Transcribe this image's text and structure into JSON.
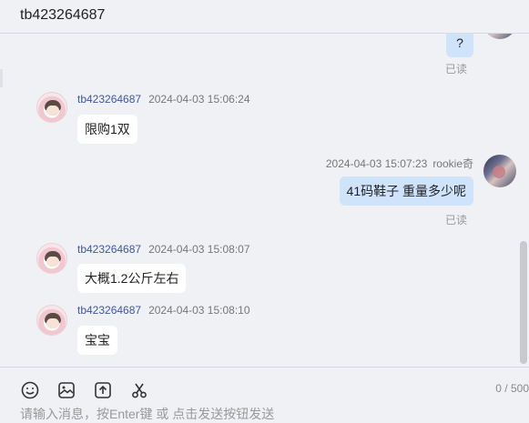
{
  "header": {
    "title": "tb423264687"
  },
  "messages": [
    {
      "side": "out",
      "text": "?",
      "status": "已读"
    },
    {
      "side": "in",
      "name": "tb423264687",
      "time": "2024-04-03 15:06:24",
      "text": "限购1双"
    },
    {
      "side": "out",
      "name": "rookie奇",
      "time": "2024-04-03 15:07:23",
      "text": "41码鞋子 重量多少呢",
      "status": "已读"
    },
    {
      "side": "in",
      "name": "tb423264687",
      "time": "2024-04-03 15:08:07",
      "text": "大概1.2公斤左右"
    },
    {
      "side": "in",
      "name": "tb423264687",
      "time": "2024-04-03 15:08:10",
      "text": "宝宝"
    }
  ],
  "toolbar": {
    "icons": [
      "emoji-icon",
      "image-icon",
      "upload-icon",
      "scissors-icon"
    ],
    "counter": "0 / 500"
  },
  "input": {
    "placeholder": "请输入消息，按Enter键 或 点击发送按钮发送"
  }
}
